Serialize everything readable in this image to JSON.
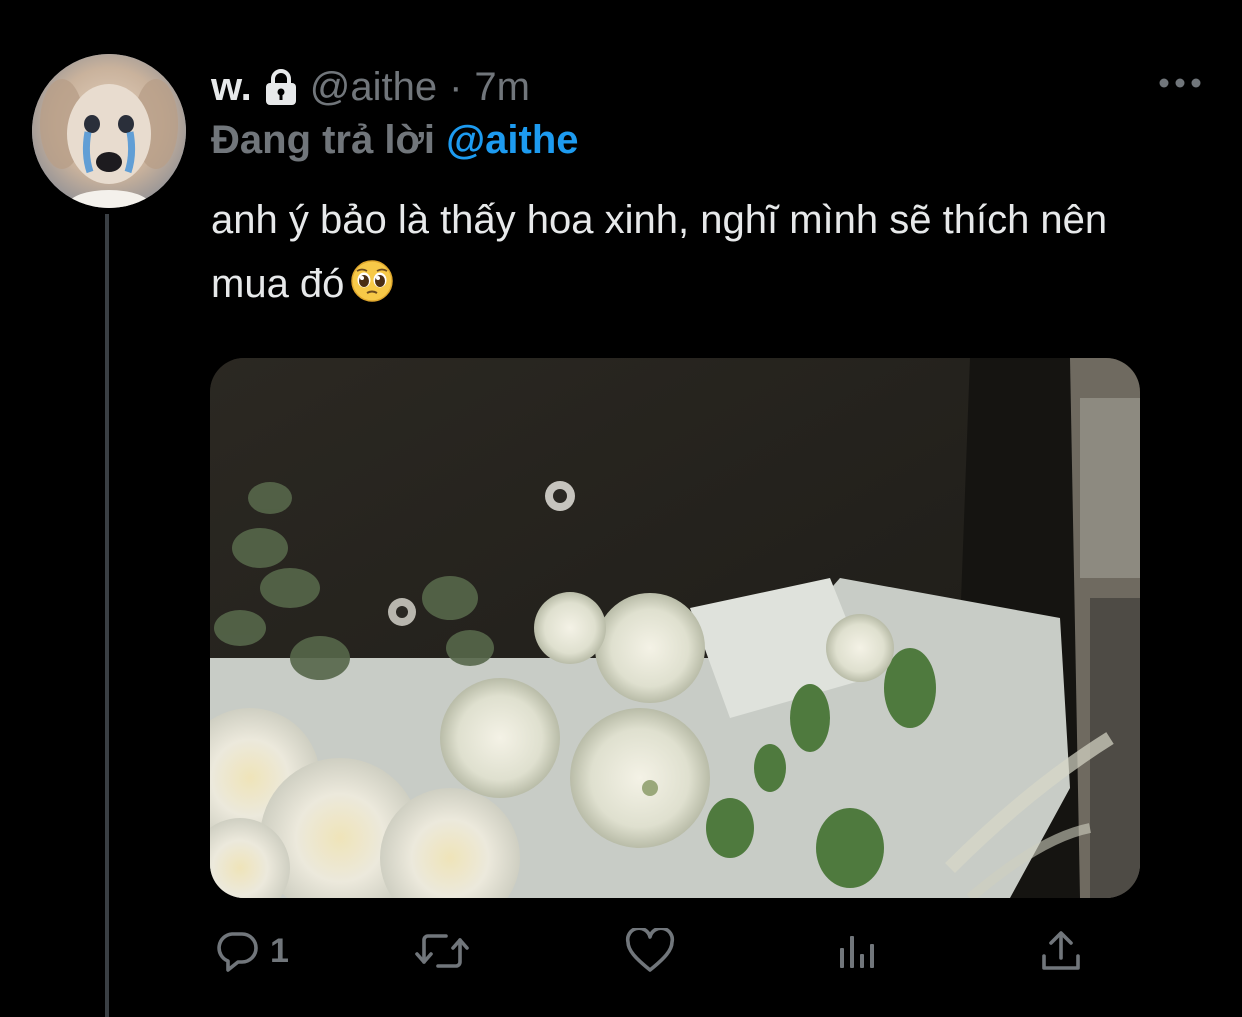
{
  "tweet": {
    "display_name": "w.",
    "handle": "@aithe",
    "separator": "·",
    "time": "7m",
    "replying_prefix": "Đang trả lời",
    "replying_to": "@aithe",
    "text": "anh ý bảo là thấy hoa xinh, nghĩ mình sẽ thích nên mua đó",
    "emoji_icon": "pleading-face-emoji"
  },
  "actions": {
    "reply_count": "1",
    "retweet_count": "",
    "like_count": ""
  },
  "colors": {
    "background": "#000000",
    "primary_text": "#e7e9ea",
    "secondary_text": "#71767b",
    "accent": "#1d9bf0",
    "thread_line": "#3a3f44"
  },
  "icons": {
    "lock": "lock-icon",
    "more": "more-icon",
    "reply": "reply-icon",
    "retweet": "retweet-icon",
    "like": "heart-icon",
    "analytics": "analytics-icon",
    "share": "share-icon"
  }
}
